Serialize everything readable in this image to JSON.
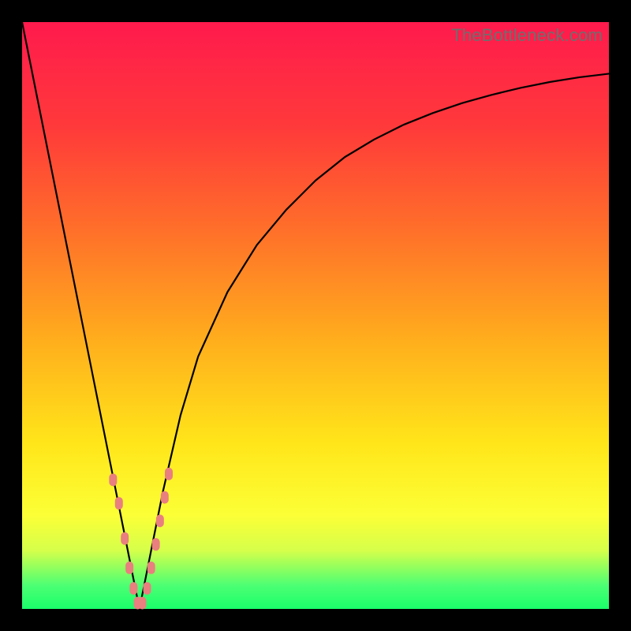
{
  "watermark": "TheBottleneck.com",
  "chart_data": {
    "type": "line",
    "title": "",
    "xlabel": "",
    "ylabel": "",
    "xlim": [
      0,
      100
    ],
    "ylim": [
      0,
      100
    ],
    "minimum_x": 20,
    "series": [
      {
        "name": "bottleneck-curve",
        "x": [
          0,
          2,
          5,
          8,
          11,
          14,
          16,
          18,
          19,
          20,
          21,
          22,
          24,
          27,
          30,
          35,
          40,
          45,
          50,
          55,
          60,
          65,
          70,
          75,
          80,
          85,
          90,
          95,
          100
        ],
        "y": [
          100,
          90,
          75,
          60,
          45,
          30,
          20,
          10,
          5,
          0,
          5,
          10,
          20,
          33,
          43,
          54,
          62,
          68,
          73,
          77,
          80,
          82.5,
          84.5,
          86.2,
          87.6,
          88.8,
          89.8,
          90.6,
          91.2
        ]
      }
    ],
    "markers": {
      "name": "highlight-points",
      "points": [
        {
          "x": 15.5,
          "y": 22
        },
        {
          "x": 16.5,
          "y": 18
        },
        {
          "x": 17.5,
          "y": 12
        },
        {
          "x": 18.3,
          "y": 7
        },
        {
          "x": 19,
          "y": 3.5
        },
        {
          "x": 19.7,
          "y": 1
        },
        {
          "x": 20.5,
          "y": 1
        },
        {
          "x": 21.3,
          "y": 3.5
        },
        {
          "x": 22,
          "y": 7
        },
        {
          "x": 22.8,
          "y": 11
        },
        {
          "x": 23.5,
          "y": 15
        },
        {
          "x": 24.3,
          "y": 19
        },
        {
          "x": 25,
          "y": 23
        }
      ]
    },
    "gradient_note": "background vertical gradient red→yellow→green, green at bottom indicates optimal"
  }
}
